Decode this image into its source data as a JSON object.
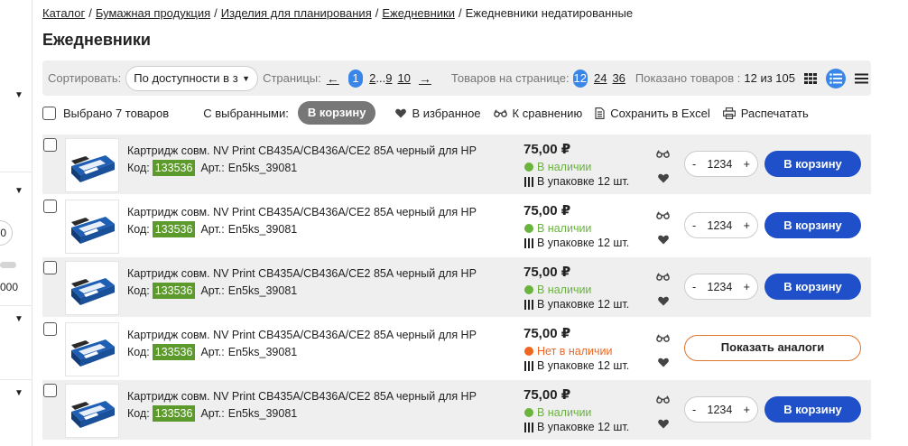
{
  "breadcrumb": [
    {
      "label": "Каталог",
      "link": true
    },
    {
      "label": "Бумажная продукция",
      "link": true
    },
    {
      "label": "Изделия для планирования",
      "link": true
    },
    {
      "label": "Ежедневники",
      "link": true
    },
    {
      "label": "Ежедневники недатированные",
      "link": false
    }
  ],
  "page_title": "Ежедневники",
  "sidebar": {
    "partial_value_1": "0",
    "partial_value_2": "000"
  },
  "toolbar": {
    "sort_label": "Сортировать:",
    "sort_value": "По доступности в заказ",
    "pages_label": "Страницы:",
    "prev_arrow": "←",
    "current_page": "1",
    "page_2": "2",
    "page_ellipsis": "...",
    "page_9": "9",
    "page_10": "10",
    "next_arrow": "→",
    "per_page_label": "Товаров на странице:",
    "per_page_active": "12",
    "per_page_24": "24",
    "per_page_36": "36",
    "shown_label": "Показано товаров :",
    "shown_count": "12 из 105"
  },
  "selection": {
    "selected_label": "Выбрано 7 товаров",
    "with_selected": "С выбранными:",
    "to_cart": "В корзину",
    "to_favorites": "В избранное",
    "to_compare": "К сравнению",
    "save_excel": "Сохранить в Excel",
    "print": "Распечатать"
  },
  "colors": {
    "accent": "#1f4fc9",
    "page_active": "#3a86e8",
    "in_stock": "#6ab33f",
    "out_of_stock": "#f0661f",
    "code_badge": "#5c9b2b"
  },
  "products": [
    {
      "name": "Картридж совм. NV Print  CB435A/CB436A/CE2 85A черный для HP",
      "code_label": "Код:",
      "code": "133536",
      "art_label": "Арт.:",
      "art": "En5ks_39081",
      "price": "75,00 ₽",
      "stock": "В наличии",
      "in_stock": true,
      "pack": "В упаковке 12 шт.",
      "qty": "1234",
      "cart_label": "В корзину"
    },
    {
      "name": "Картридж совм. NV Print  CB435A/CB436A/CE2 85A черный для HP",
      "code_label": "Код:",
      "code": "133536",
      "art_label": "Арт.:",
      "art": "En5ks_39081",
      "price": "75,00 ₽",
      "stock": "В наличии",
      "in_stock": true,
      "pack": "В упаковке 12 шт.",
      "qty": "1234",
      "cart_label": "В корзину"
    },
    {
      "name": "Картридж совм. NV Print  CB435A/CB436A/CE2 85A черный для HP",
      "code_label": "Код:",
      "code": "133536",
      "art_label": "Арт.:",
      "art": "En5ks_39081",
      "price": "75,00 ₽",
      "stock": "В наличии",
      "in_stock": true,
      "pack": "В упаковке 12 шт.",
      "qty": "1234",
      "cart_label": "В корзину"
    },
    {
      "name": "Картридж совм. NV Print  CB435A/CB436A/CE2 85A черный для HP",
      "code_label": "Код:",
      "code": "133536",
      "art_label": "Арт.:",
      "art": "En5ks_39081",
      "price": "75,00 ₽",
      "stock": "Нет в наличии",
      "in_stock": false,
      "pack": "В упаковке 12 шт.",
      "analog_label": "Показать аналоги"
    },
    {
      "name": "Картридж совм. NV Print  CB435A/CB436A/CE2 85A черный для HP",
      "code_label": "Код:",
      "code": "133536",
      "art_label": "Арт.:",
      "art": "En5ks_39081",
      "price": "75,00 ₽",
      "stock": "В наличии",
      "in_stock": true,
      "pack": "В упаковке 12 шт.",
      "qty": "1234",
      "cart_label": "В корзину"
    }
  ]
}
